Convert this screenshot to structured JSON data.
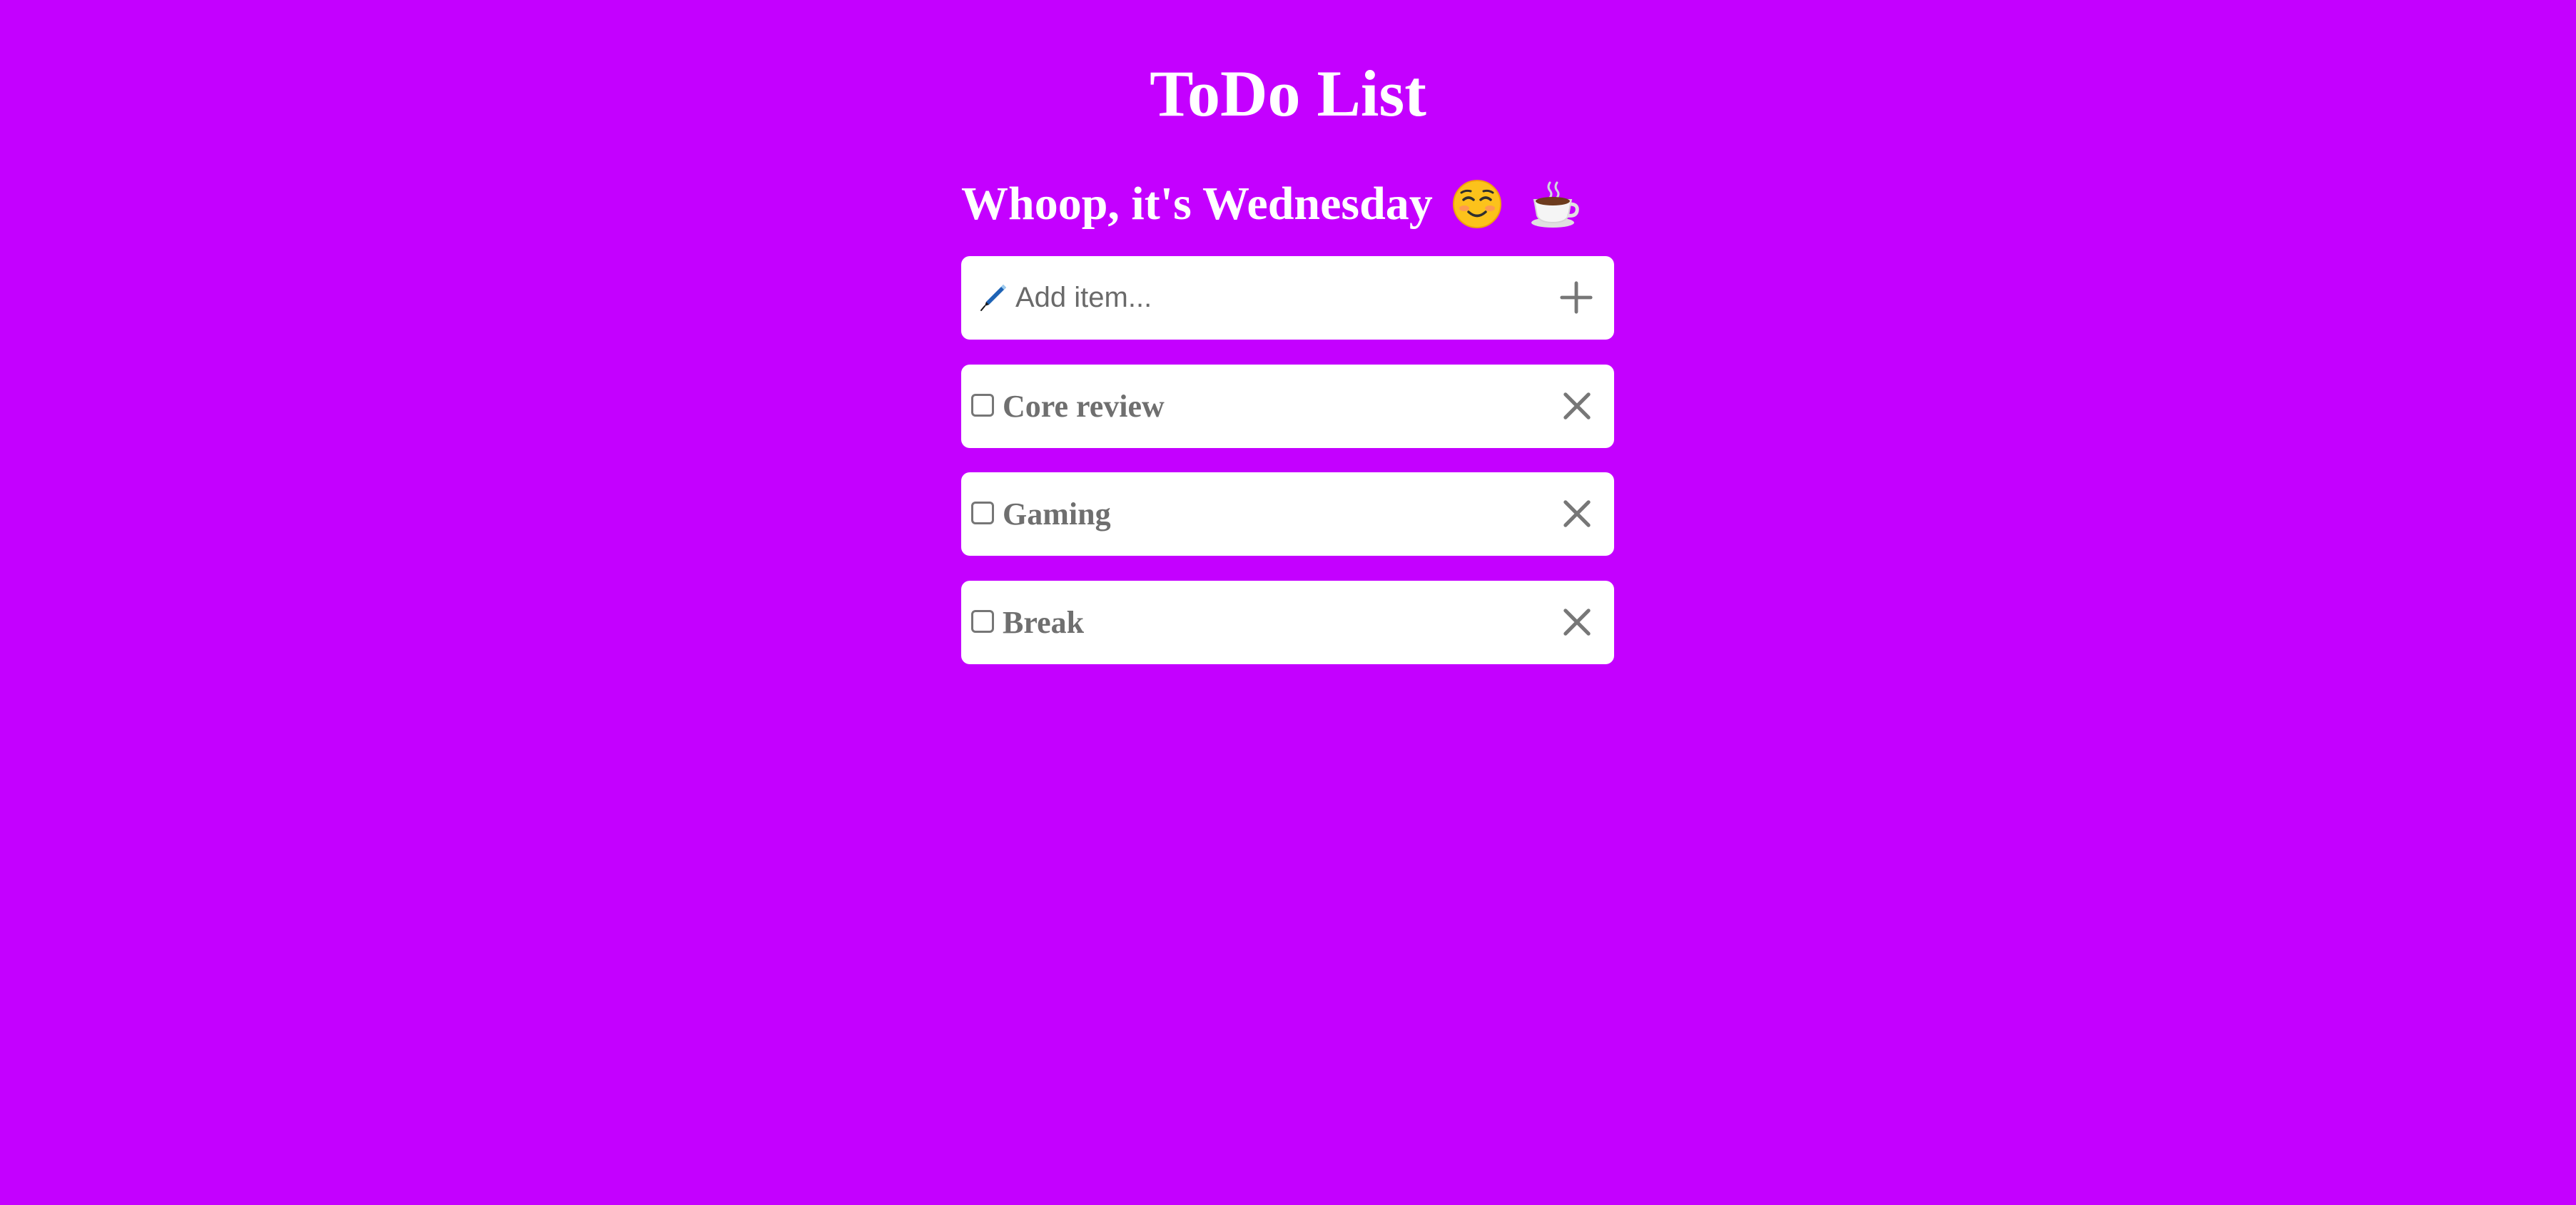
{
  "header": {
    "title": "ToDo List",
    "greeting": "Whoop, it's Wednesday",
    "emojis": [
      "smiling-face-icon",
      "hot-beverage-icon"
    ]
  },
  "add_item": {
    "placeholder": "Add item...",
    "value": "",
    "icon": "pen-icon",
    "button_icon": "plus-icon"
  },
  "items": [
    {
      "label": "Core review",
      "checked": false
    },
    {
      "label": "Gaming",
      "checked": false
    },
    {
      "label": "Break",
      "checked": false
    }
  ],
  "colors": {
    "background": "#c400ff",
    "card": "#ffffff",
    "item_text": "#6f6f6f",
    "icon": "#777777"
  }
}
